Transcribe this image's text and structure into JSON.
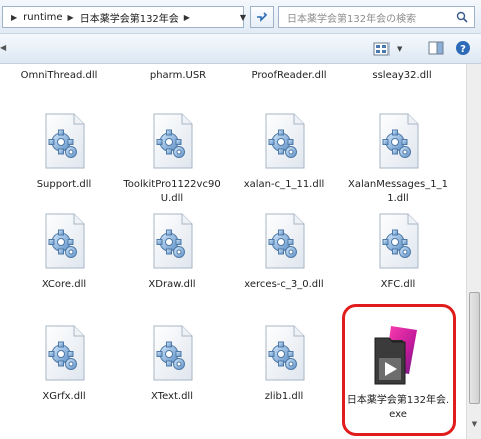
{
  "address_bar": {
    "crumbs": [
      "runtime",
      "日本薬学会第132年会"
    ],
    "search_placeholder": "日本薬学会第132年会の検索"
  },
  "toolbar": {
    "icons": [
      "views-icon",
      "dropdown-icon",
      "preview-pane-icon",
      "help-icon"
    ]
  },
  "top_row": [
    "OmniThread.dll",
    "pharm.USR",
    "ProofReader.dll",
    "ssleay32.dll"
  ],
  "files": [
    {
      "name": "Support.dll",
      "icon": "dll-gear-icon"
    },
    {
      "name": "ToolkitPro1122vc90U.dll",
      "icon": "dll-gear-icon"
    },
    {
      "name": "xalan-c_1_11.dll",
      "icon": "dll-gear-icon"
    },
    {
      "name": "XalanMessages_1_11.dll",
      "icon": "dll-gear-icon"
    },
    {
      "name": "XCore.dll",
      "icon": "dll-gear-icon"
    },
    {
      "name": "XDraw.dll",
      "icon": "dll-gear-icon"
    },
    {
      "name": "xerces-c_3_0.dll",
      "icon": "dll-gear-icon"
    },
    {
      "name": "XFC.dll",
      "icon": "dll-gear-icon"
    },
    {
      "name": "XGrfx.dll",
      "icon": "dll-gear-icon"
    },
    {
      "name": "XText.dll",
      "icon": "dll-gear-icon"
    },
    {
      "name": "zlib1.dll",
      "icon": "dll-gear-icon"
    },
    {
      "name": "日本薬学会第132年会.exe",
      "icon": "exe-app-icon"
    }
  ],
  "highlight_color": "#e11c1c"
}
